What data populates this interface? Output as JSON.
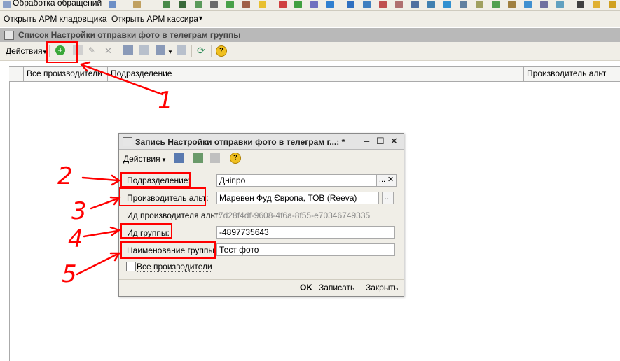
{
  "top_toolbar": {
    "label": "Обработка обращений"
  },
  "quick_links": {
    "storekeeper": "Открыть АРМ кладовщика",
    "cashier": "Открыть АРМ кассира"
  },
  "list_window": {
    "title": "Список Настройки отправки фото в телеграм группы",
    "actions_label": "Действия",
    "columns": [
      "Все производители",
      "Подразделение",
      "Производитель альт"
    ]
  },
  "dialog": {
    "title": "Запись Настройки отправки фото в телеграм г...:  *",
    "actions_label": "Действия",
    "fields": {
      "department_label": "Подразделение:",
      "department_value": "Дніпро",
      "alt_producer_label": "Производитель альт:",
      "alt_producer_value": "Маревен Фуд Європа, ТОВ (Reeva)",
      "alt_producer_id_label": "Ид производителя альт:",
      "alt_producer_id_value": "7d28f4df-9608-4f6a-8f55-e70346749335",
      "group_id_label": "Ид группы:",
      "group_id_value": "-4897735643",
      "group_name_label": "Наименование группы:",
      "group_name_value": "Тест фото",
      "all_producers_label": "Все производители"
    },
    "footer": {
      "ok": "OK",
      "save": "Записать",
      "close": "Закрыть"
    }
  },
  "annotations": [
    "1",
    "2",
    "3",
    "4",
    "5"
  ],
  "colors": {
    "annotation": "#ff0000",
    "add_button": "#3aa83a",
    "chrome": "#f0eee7"
  }
}
